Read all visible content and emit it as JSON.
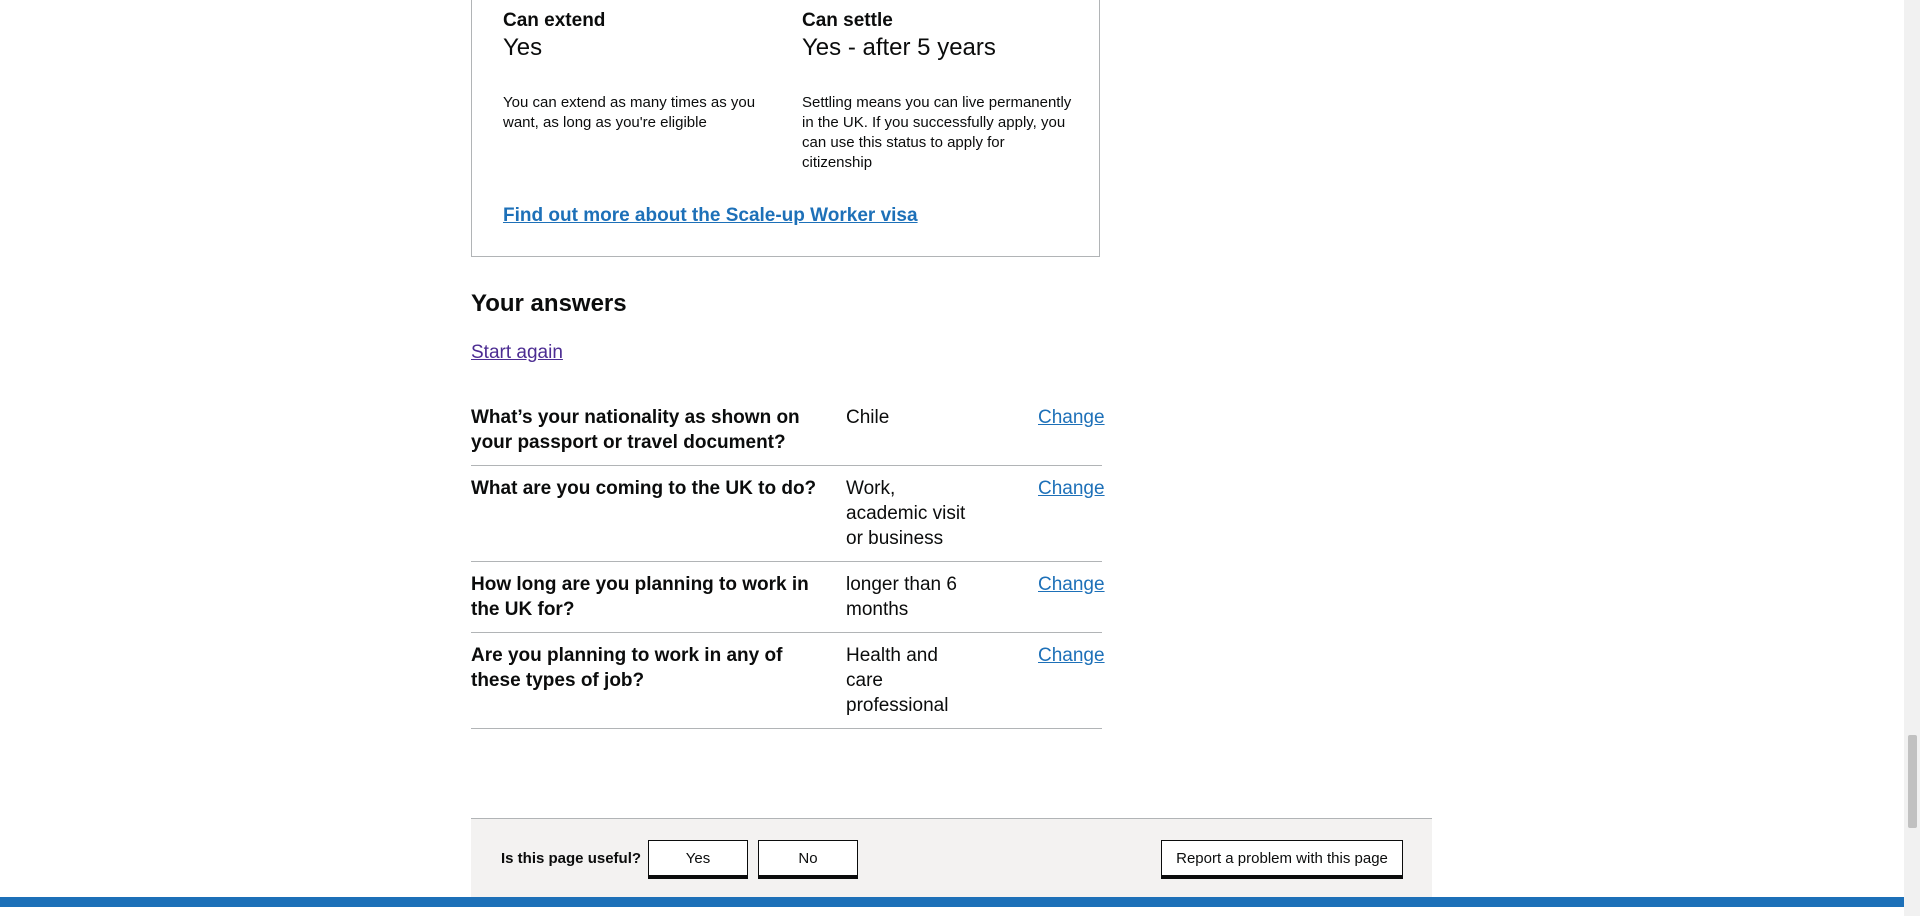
{
  "visa_card": {
    "extend": {
      "title": "Can extend",
      "value": "Yes",
      "desc": "You can extend as many times as you want, as long as you're eligible"
    },
    "settle": {
      "title": "Can settle",
      "value": "Yes - after 5 years",
      "desc": "Settling means you can live permanently in the UK. If you successfully apply, you can use this status to apply for citizenship"
    },
    "more_link": "Find out more about the Scale-up Worker visa"
  },
  "answers": {
    "title": "Your answers",
    "start_again": "Start again",
    "rows": [
      {
        "question": "What’s your nationality as shown on your passport or travel document?",
        "answer": "Chile",
        "change": "Change"
      },
      {
        "question": "What are you coming to the UK to do?",
        "answer": "Work, academic visit or business",
        "change": "Change"
      },
      {
        "question": "How long are you planning to work in the UK for?",
        "answer": "longer than 6 months",
        "change": "Change"
      },
      {
        "question": "Are you planning to work in any of these types of job?",
        "answer": "Health and care professional",
        "change": "Change"
      }
    ]
  },
  "feedback": {
    "question": "Is this page useful?",
    "yes": "Yes",
    "no": "No",
    "report": "Report a problem with this page"
  },
  "colors": {
    "link": "#1d70b8",
    "visited": "#4c2c92",
    "text": "#0b0c0c",
    "footer_bar": "#1d70b8"
  }
}
